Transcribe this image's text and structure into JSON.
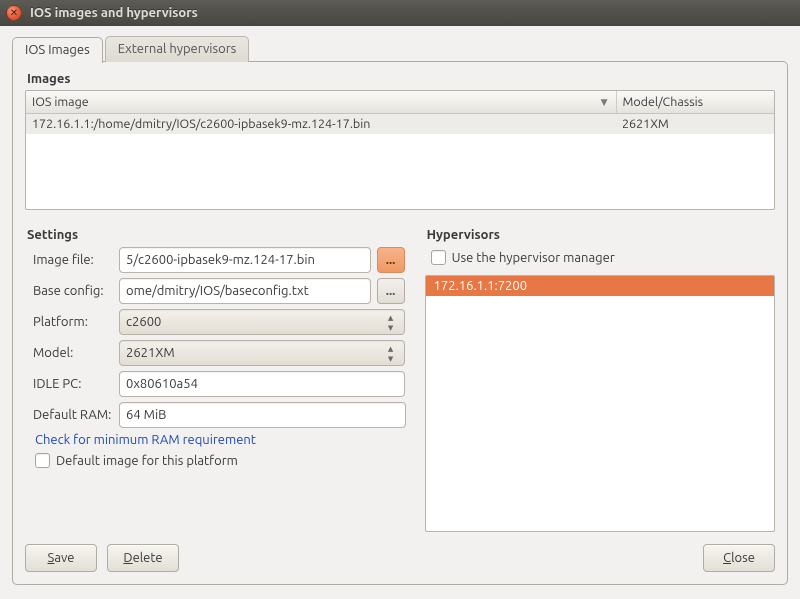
{
  "window": {
    "title": "IOS images and hypervisors"
  },
  "tabs": [
    {
      "label": "IOS Images",
      "active": true
    },
    {
      "label": "External hypervisors",
      "active": false
    }
  ],
  "images_section": {
    "title": "Images",
    "columns": {
      "image": "IOS image",
      "model": "Model/Chassis"
    },
    "rows": [
      {
        "image": "172.16.1.1:/home/dmitry/IOS/c2600-ipbasek9-mz.124-17.bin",
        "model": "2621XM"
      }
    ]
  },
  "settings": {
    "title": "Settings",
    "image_file": {
      "label": "Image file:",
      "value": "5/c2600-ipbasek9-mz.124-17.bin"
    },
    "base_config": {
      "label": "Base config:",
      "value": "ome/dmitry/IOS/baseconfig.txt"
    },
    "platform": {
      "label": "Platform:",
      "value": "c2600"
    },
    "model": {
      "label": "Model:",
      "value": "2621XM"
    },
    "idle_pc": {
      "label": "IDLE PC:",
      "value": "0x80610a54"
    },
    "default_ram": {
      "label": "Default RAM:",
      "value": "64 MiB"
    },
    "ram_link": "Check for minimum RAM requirement",
    "default_image_label": "Default image for this platform",
    "default_image_checked": false
  },
  "hypervisors": {
    "title": "Hypervisors",
    "use_manager_label": "Use the hypervisor manager",
    "use_manager_checked": false,
    "items": [
      "172.16.1.1:7200"
    ]
  },
  "buttons": {
    "save": {
      "mnemonic": "S",
      "rest": "ave"
    },
    "delete": {
      "mnemonic": "D",
      "rest": "elete"
    },
    "close": {
      "mnemonic": "C",
      "rest": "lose"
    },
    "browse": "..."
  },
  "colors": {
    "accent": "#e77745"
  }
}
